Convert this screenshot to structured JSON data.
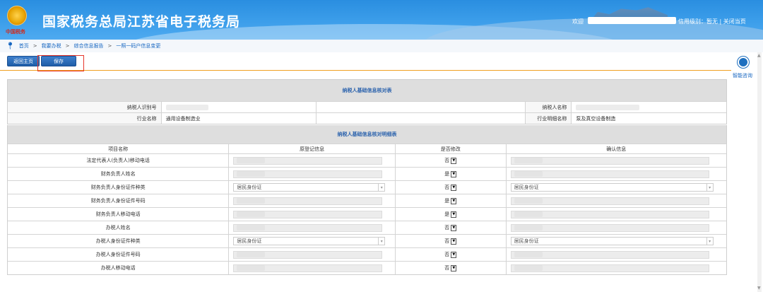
{
  "header": {
    "title": "国家税务总局江苏省电子税务局",
    "emblem_caption": "中国税务",
    "welcome": "欢迎",
    "credit_label": "信用级别：暂无",
    "separator": "|",
    "close_page": "关闭当页"
  },
  "breadcrumb": {
    "home": "首页",
    "sep": ">",
    "items": [
      "我要办税",
      "综合信息报告",
      "一照一码户信息变更"
    ]
  },
  "toolbar": {
    "back_label": "返回主页",
    "save_label": "保存"
  },
  "help": {
    "label": "智能咨询"
  },
  "basic_table": {
    "title": "纳税人基础信息核对表",
    "rows": [
      {
        "l1": "纳税人识别号",
        "v1": "",
        "l2": "纳税人名称",
        "v2": ""
      },
      {
        "l1": "行业名称",
        "v1": "通用设备制造业",
        "l2": "行业明细名称",
        "v2": "泵及真空设备制造"
      }
    ]
  },
  "detail_table": {
    "title": "纳税人基础信息核对明细表",
    "headers": [
      "项目名称",
      "原登记信息",
      "是否修改",
      "确认信息"
    ],
    "rows": [
      {
        "name": "法定代表人(负责人)移动电话",
        "orig": "",
        "orig_select": false,
        "modify": "否",
        "confirm": "",
        "confirm_select": false
      },
      {
        "name": "财务负责人姓名",
        "orig": "",
        "orig_select": false,
        "modify": "是",
        "confirm": "",
        "confirm_select": false
      },
      {
        "name": "财务负责人身份证件种类",
        "orig": "居民身份证",
        "orig_select": true,
        "modify": "否",
        "confirm": "居民身份证",
        "confirm_select": true
      },
      {
        "name": "财务负责人身份证件号码",
        "orig": "",
        "orig_select": false,
        "modify": "是",
        "confirm": "",
        "confirm_select": false
      },
      {
        "name": "财务负责人移动电话",
        "orig": "",
        "orig_select": false,
        "modify": "是",
        "confirm": "",
        "confirm_select": false
      },
      {
        "name": "办税人姓名",
        "orig": "",
        "orig_select": false,
        "modify": "否",
        "confirm": "",
        "confirm_select": false
      },
      {
        "name": "办税人身份证件种类",
        "orig": "居民身份证",
        "orig_select": true,
        "modify": "否",
        "confirm": "居民身份证",
        "confirm_select": true
      },
      {
        "name": "办税人身份证件号码",
        "orig": "",
        "orig_select": false,
        "modify": "否",
        "confirm": "",
        "confirm_select": false
      },
      {
        "name": "办税人移动电话",
        "orig": "",
        "orig_select": false,
        "modify": "否",
        "confirm": "",
        "confirm_select": false
      }
    ]
  },
  "colors": {
    "brand_blue": "#2a8ee0",
    "accent_orange": "#f0a020",
    "highlight_red": "#e5352b"
  }
}
